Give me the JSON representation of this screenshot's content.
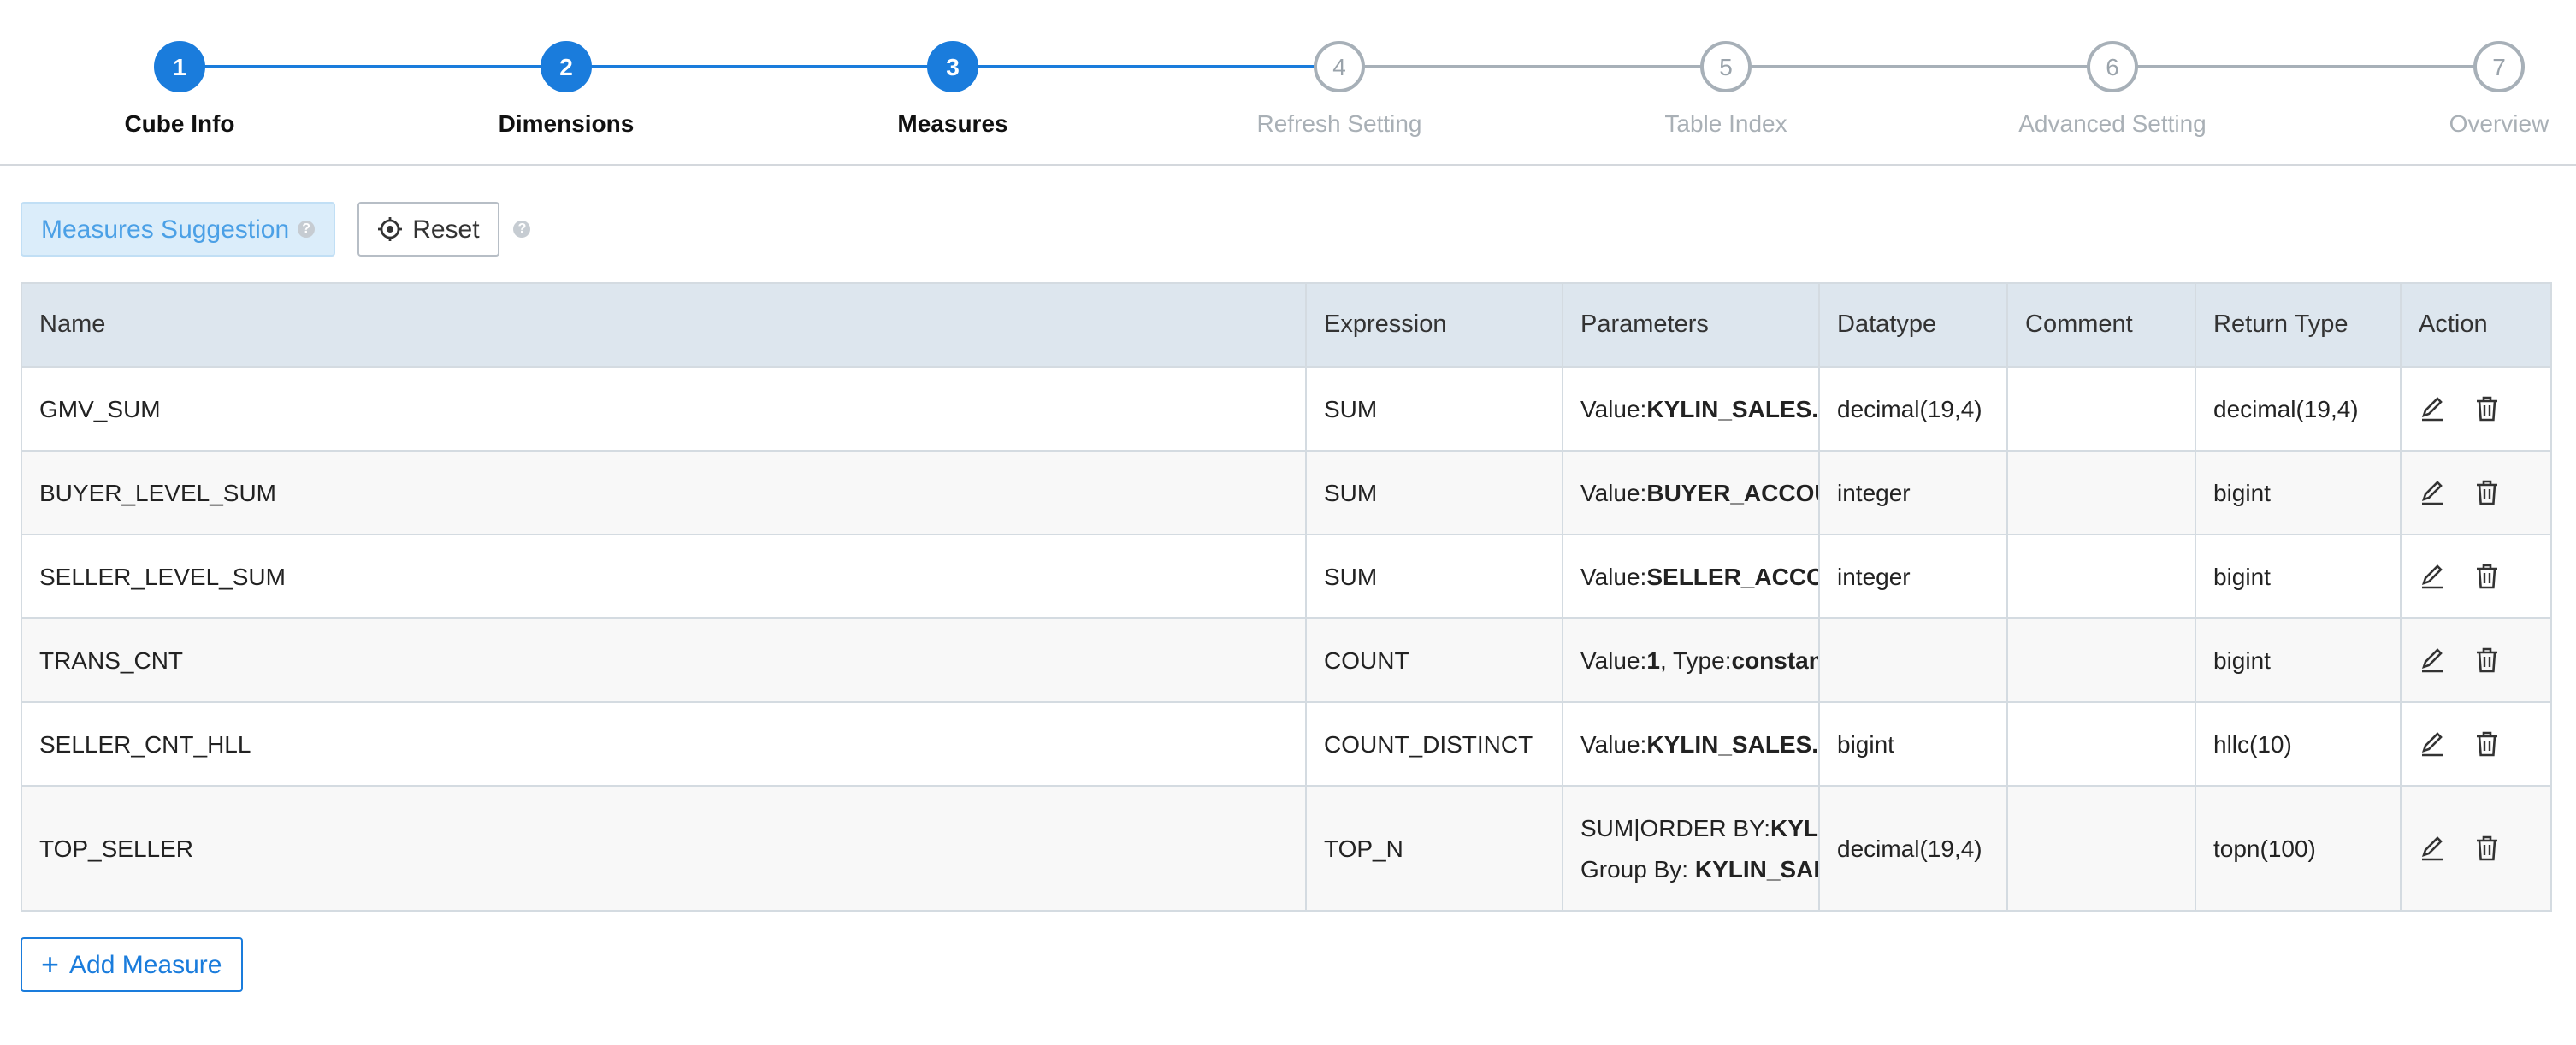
{
  "steps": [
    {
      "num": "1",
      "label": "Cube Info",
      "state": "done"
    },
    {
      "num": "2",
      "label": "Dimensions",
      "state": "done"
    },
    {
      "num": "3",
      "label": "Measures",
      "state": "done"
    },
    {
      "num": "4",
      "label": "Refresh Setting",
      "state": "todo"
    },
    {
      "num": "5",
      "label": "Table Index",
      "state": "todo"
    },
    {
      "num": "6",
      "label": "Advanced Setting",
      "state": "todo"
    },
    {
      "num": "7",
      "label": "Overview",
      "state": "todo"
    }
  ],
  "toolbar": {
    "suggestion_label": "Measures Suggestion",
    "reset_label": "Reset",
    "help_glyph": "?"
  },
  "table": {
    "headers": [
      "Name",
      "Expression",
      "Parameters",
      "Datatype",
      "Comment",
      "Return Type",
      "Action"
    ],
    "rows": [
      {
        "name": "GMV_SUM",
        "expression": "SUM",
        "param_prefix": "Value:",
        "param_value": "KYLIN_SALES.PRICE",
        "param_line2_prefix": "",
        "param_line2_value": "",
        "datatype": "decimal(19,4)",
        "comment": "",
        "return_type": "decimal(19,4)"
      },
      {
        "name": "BUYER_LEVEL_SUM",
        "expression": "SUM",
        "param_prefix": "Value:",
        "param_value": "BUYER_ACCOUNT.ACCOUNT_BUYER_LEVEL",
        "param_line2_prefix": "",
        "param_line2_value": "",
        "datatype": "integer",
        "comment": "",
        "return_type": "bigint"
      },
      {
        "name": "SELLER_LEVEL_SUM",
        "expression": "SUM",
        "param_prefix": "Value:",
        "param_value": "SELLER_ACCOUNT.ACCOUNT_SELLER_LEVEL",
        "param_line2_prefix": "",
        "param_line2_value": "",
        "datatype": "integer",
        "comment": "",
        "return_type": "bigint"
      },
      {
        "name": "TRANS_CNT",
        "expression": "COUNT",
        "param_prefix": "Value:",
        "param_value": "1",
        "param_mid": ", Type:",
        "param_value2": "constant",
        "param_line2_prefix": "",
        "param_line2_value": "",
        "datatype": "",
        "comment": "",
        "return_type": "bigint"
      },
      {
        "name": "SELLER_CNT_HLL",
        "expression": "COUNT_DISTINCT",
        "param_prefix": "Value:",
        "param_value": "KYLIN_SALES.SELLER_ID",
        "param_line2_prefix": "",
        "param_line2_value": "",
        "datatype": "bigint",
        "comment": "",
        "return_type": "hllc(10)"
      },
      {
        "name": "TOP_SELLER",
        "expression": "TOP_N",
        "param_prefix": "SUM|ORDER BY:",
        "param_value": "KYLIN_SALES.PRICE",
        "param_line2_prefix": "Group By: ",
        "param_line2_value": "KYLIN_SALES.SELLER_ID",
        "datatype": "decimal(19,4)",
        "comment": "",
        "return_type": "topn(100)"
      }
    ]
  },
  "add_measure_label": "Add Measure",
  "colors": {
    "accent": "#1a7cdc",
    "header_bg": "#dde6ee",
    "inactive": "#a9b0b6"
  }
}
